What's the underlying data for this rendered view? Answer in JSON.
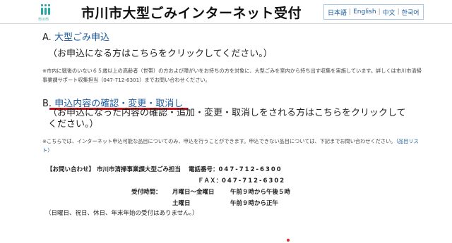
{
  "header": {
    "logo_caption": "市川市",
    "title": "市川市大型ごみインターネット受付",
    "languages": [
      "日本語",
      "English",
      "中文",
      "한국어"
    ],
    "lang_separator": "|"
  },
  "sectionA": {
    "letter": "A.",
    "link_label": "大型ごみ申込",
    "description": "（お申込になる方はこちらをクリックしてください。）",
    "note": "※市内に戦後のいない６５歳以上の高齢者（世帯）の方および障がいをお持ちの方を対象に、大型ごみを室内から持ち出す収集を実施しています。詳しくは市川市清掃事業課サポート収集担当（047-712-6301）までお問い合わせください。"
  },
  "sectionB": {
    "letter": "B.",
    "link_label": "申込内容の確認・変更・取消し",
    "description": "（お申込になった内容の確認・追加・変更・取消しをされる方はこちらをクリックしてください。）",
    "note_text": "※こちらでは、インターネット申込可能な品目についてのみ、申込を行うことができます。申込できない品目については、下記までお問い合わせください。",
    "note_link": "（品目リスト）"
  },
  "contact": {
    "heading": "【お問い合わせ】",
    "office": "市川市清掃事業課大型ごみ担当",
    "tel_label": "電話番号：",
    "tel": "047-712-6300",
    "fax_label": "ＦＡＸ：",
    "fax": "047-712-6302",
    "hours_label": "受付時間：",
    "weekday_label": "月曜日～金曜日",
    "weekday_hours": "午前９時から午後５時",
    "saturday_label": "土曜日",
    "saturday_hours": "午前９時から正午",
    "closed_note": "（日曜日、祝日、休日、年末年始の受付はありません。）"
  }
}
